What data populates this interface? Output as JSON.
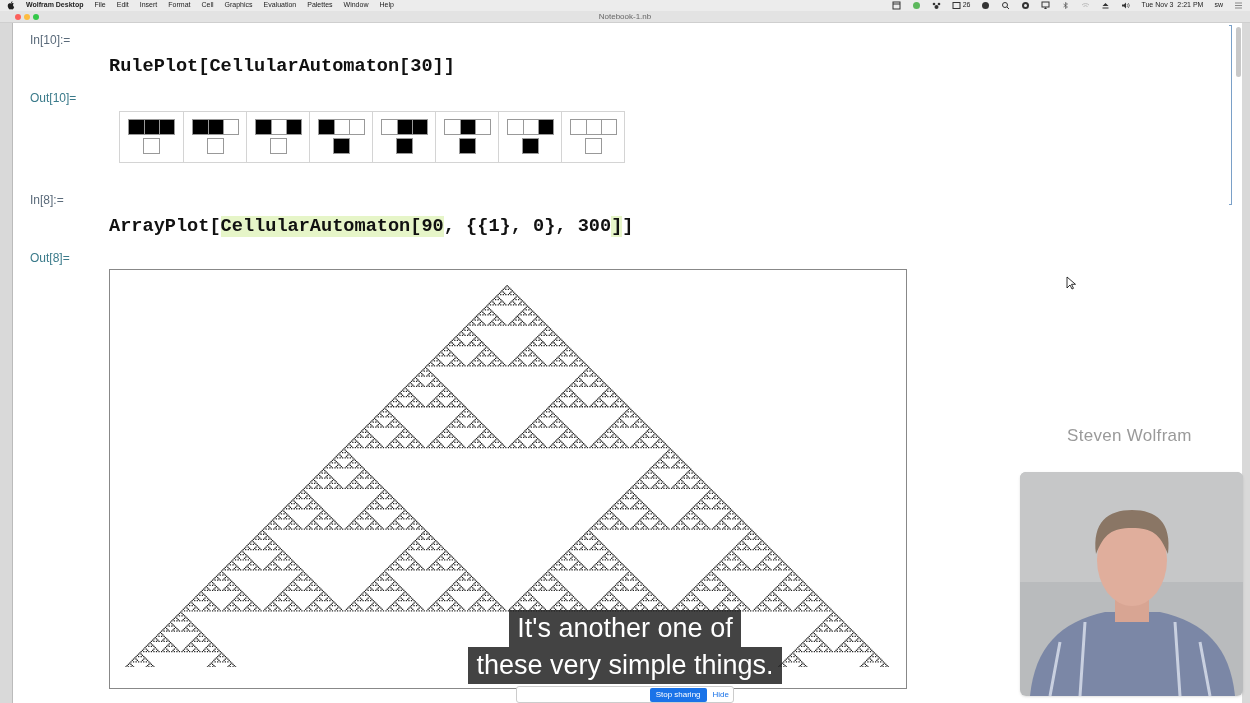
{
  "menu_bar": {
    "app": "Wolfram Desktop",
    "menus": [
      "File",
      "Edit",
      "Insert",
      "Format",
      "Cell",
      "Graphics",
      "Evaluation",
      "Palettes",
      "Window",
      "Help"
    ],
    "badge_count": "26",
    "clock": "Tue Nov 3  2:21 PM",
    "user": "sw"
  },
  "window": {
    "title": "Notebook-1.nb"
  },
  "cells": [
    {
      "kind": "rules",
      "in_label": "In[10]:=",
      "code": [
        {
          "text": "RulePlot[CellularAutomaton[30]]",
          "highlight": false
        }
      ],
      "out_label": "Out[10]=",
      "rules": [
        {
          "cells": [
            true,
            true,
            true
          ],
          "output": false
        },
        {
          "cells": [
            true,
            true,
            false
          ],
          "output": false
        },
        {
          "cells": [
            true,
            false,
            true
          ],
          "output": false
        },
        {
          "cells": [
            true,
            false,
            false
          ],
          "output": true
        },
        {
          "cells": [
            false,
            true,
            true
          ],
          "output": true
        },
        {
          "cells": [
            false,
            true,
            false
          ],
          "output": true
        },
        {
          "cells": [
            false,
            false,
            true
          ],
          "output": true
        },
        {
          "cells": [
            false,
            false,
            false
          ],
          "output": false
        }
      ]
    },
    {
      "kind": "array",
      "in_label": "In[8]:=",
      "code": [
        {
          "text": "ArrayPlot[",
          "highlight": false
        },
        {
          "text": "CellularAutomaton[90",
          "highlight": true
        },
        {
          "text": ", {{1}, 0}, 300",
          "highlight": false
        },
        {
          "text": "]",
          "highlight": true
        },
        {
          "text": "]",
          "highlight": false
        }
      ],
      "out_label": "Out[8]="
    }
  ],
  "speaker": {
    "name": "Steven Wolfram"
  },
  "subtitles": [
    "It's another one of",
    "these very simple things."
  ],
  "share_bar": {
    "buttons": [
      "Stop sharing",
      "Hide"
    ]
  }
}
